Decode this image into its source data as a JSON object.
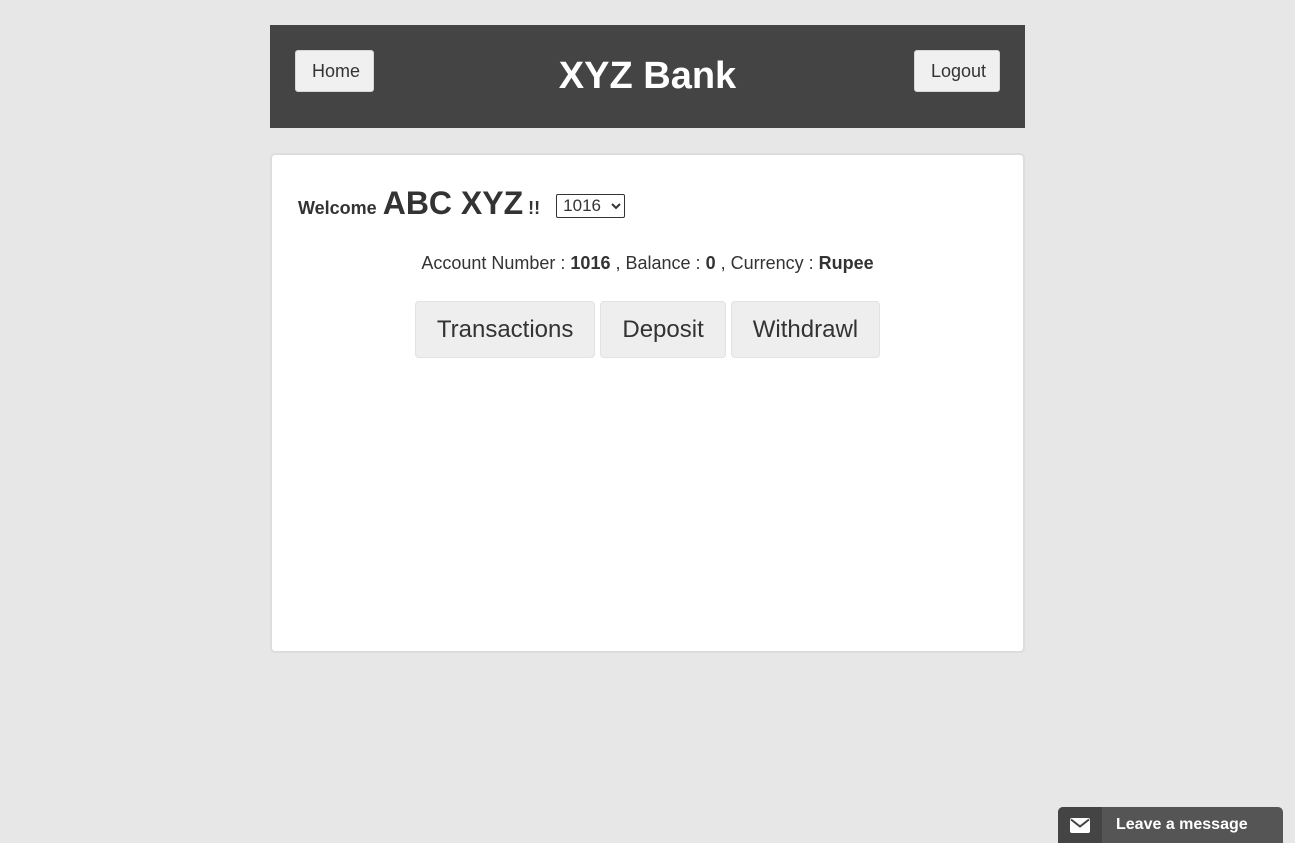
{
  "header": {
    "home_label": "Home",
    "brand": "XYZ Bank",
    "logout_label": "Logout",
    "background_color": "#444444"
  },
  "welcome": {
    "prefix": "Welcome",
    "user_name": "ABC XYZ",
    "suffix": "!!",
    "account_select": {
      "selected": "1016",
      "options": [
        "1016"
      ]
    }
  },
  "account": {
    "number_label": "Account Number :",
    "number": "1016",
    "balance_label": ", Balance :",
    "balance": "0",
    "currency_label": ", Currency :",
    "currency": "Rupee"
  },
  "actions": [
    {
      "label": "Transactions"
    },
    {
      "label": "Deposit"
    },
    {
      "label": "Withdrawl"
    }
  ],
  "chat_widget": {
    "label": "Leave a message",
    "icon": "envelope-icon"
  }
}
